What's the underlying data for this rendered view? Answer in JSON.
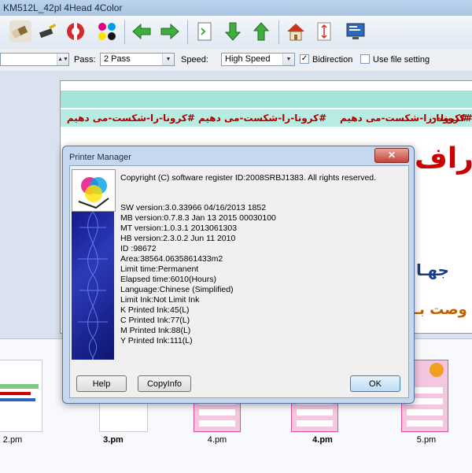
{
  "window": {
    "title": "KM512L_42pl 4Head 4Color"
  },
  "toolbar": {
    "icons": [
      "eraser-icon",
      "broom-icon",
      "lifebuoy-icon",
      "color-dots-icon",
      "arrow-left-icon",
      "arrow-right-icon",
      "page-icon",
      "arrow-down-icon",
      "arrow-up-icon",
      "home-icon",
      "vertical-measure-icon",
      "monitor-icon"
    ]
  },
  "settings": {
    "pass_label": "Pass:",
    "pass_value": "2 Pass",
    "speed_label": "Speed:",
    "speed_value": "High Speed",
    "bidirection_label": "Bidirection",
    "bidirection_checked": true,
    "use_file_label": "Use file setting",
    "use_file_checked": false
  },
  "preview": {
    "repeat_text": "#کرونا-را-شکست-می دهیم",
    "banner_fragment_1": "دراف",
    "banner_fragment_2": "جهـا",
    "banner_fragment_3": "وصت بـ"
  },
  "thumbnails": [
    {
      "label": "2.pm",
      "bold": false
    },
    {
      "label": "3.pm",
      "bold": true
    },
    {
      "label": "4.pm",
      "bold": false
    },
    {
      "label": "4.pm",
      "bold": true
    },
    {
      "label": "5.pm",
      "bold": false
    }
  ],
  "dialog": {
    "title": "Printer Manager",
    "close_symbol": "✕",
    "copyright": "Copyright (C) software register ID:2008SRBJ1383. All rights reserved.",
    "info_lines": [
      "SW version:3.0.33966  04/16/2013 1852",
      "MB version:0.7.8.3 Jan 13 2015 00030100",
      "MT version:1.0.3.1 2013061303",
      "HB version:2.3.0.2 Jun 11 2010",
      "ID :98672",
      "Area:38564.0635861433m2",
      "Limit time:Permanent",
      "Elapsed time:6010(Hours)",
      "Language:Chinese (Simplified)",
      "Limit Ink:Not Limit Ink",
      "K Printed Ink:45(L)",
      "C Printed Ink:77(L)",
      "M Printed Ink:88(L)",
      "Y Printed Ink:111(L)"
    ],
    "buttons": {
      "help": "Help",
      "copyinfo": "CopyInfo",
      "ok": "OK"
    }
  },
  "colors": {
    "accent": "#3c7fb1",
    "banner_red": "#b00000",
    "stripe": "#a2e4d8"
  }
}
